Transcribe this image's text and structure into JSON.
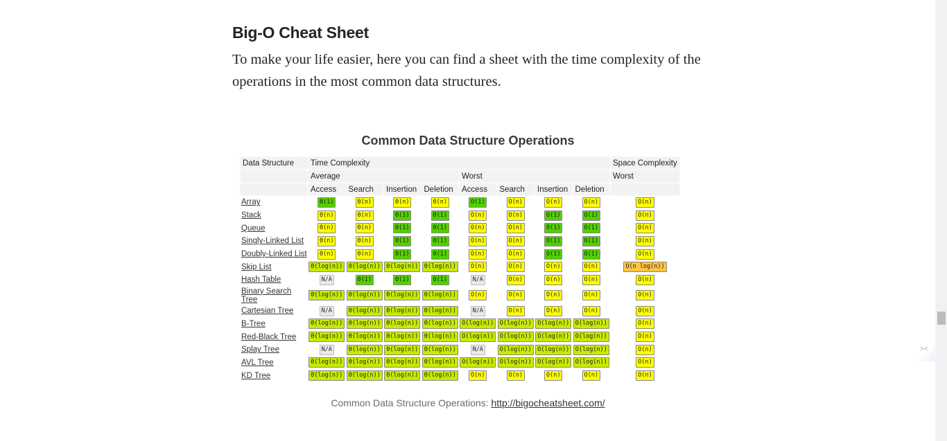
{
  "article": {
    "heading": "Big-O Cheat Sheet",
    "paragraph": "To make your life easier, here you can find a sheet with the time complexity of the operations in the most common data structures."
  },
  "figure": {
    "title": "Common Data Structure Operations",
    "caption_text": "Common Data Structure Operations: ",
    "caption_link": "http://bigocheatsheet.com/",
    "headers": {
      "data_structure": "Data Structure",
      "time_complexity": "Time Complexity",
      "space_complexity": "Space Complexity",
      "average": "Average",
      "worst": "Worst",
      "space_worst": "Worst",
      "ops": [
        "Access",
        "Search",
        "Insertion",
        "Deletion",
        "Access",
        "Search",
        "Insertion",
        "Deletion"
      ]
    },
    "colors": {
      "green": "#53d000",
      "yellow": "#ffff00",
      "yg": "#c8ea00",
      "orange": "#ffc543",
      "gray": "#eaeaea"
    },
    "rows": [
      {
        "name": "Array",
        "cells": [
          [
            "Θ(1)",
            "green"
          ],
          [
            "Θ(n)",
            "yellow"
          ],
          [
            "Θ(n)",
            "yellow"
          ],
          [
            "Θ(n)",
            "yellow"
          ],
          [
            "O(1)",
            "green"
          ],
          [
            "O(n)",
            "yellow"
          ],
          [
            "O(n)",
            "yellow"
          ],
          [
            "O(n)",
            "yellow"
          ],
          [
            "O(n)",
            "yellow"
          ]
        ]
      },
      {
        "name": "Stack",
        "cells": [
          [
            "Θ(n)",
            "yellow"
          ],
          [
            "Θ(n)",
            "yellow"
          ],
          [
            "Θ(1)",
            "green"
          ],
          [
            "Θ(1)",
            "green"
          ],
          [
            "O(n)",
            "yellow"
          ],
          [
            "O(n)",
            "yellow"
          ],
          [
            "O(1)",
            "green"
          ],
          [
            "O(1)",
            "green"
          ],
          [
            "O(n)",
            "yellow"
          ]
        ]
      },
      {
        "name": "Queue",
        "cells": [
          [
            "Θ(n)",
            "yellow"
          ],
          [
            "Θ(n)",
            "yellow"
          ],
          [
            "Θ(1)",
            "green"
          ],
          [
            "Θ(1)",
            "green"
          ],
          [
            "O(n)",
            "yellow"
          ],
          [
            "O(n)",
            "yellow"
          ],
          [
            "O(1)",
            "green"
          ],
          [
            "O(1)",
            "green"
          ],
          [
            "O(n)",
            "yellow"
          ]
        ]
      },
      {
        "name": "Singly-Linked List",
        "cells": [
          [
            "Θ(n)",
            "yellow"
          ],
          [
            "Θ(n)",
            "yellow"
          ],
          [
            "Θ(1)",
            "green"
          ],
          [
            "Θ(1)",
            "green"
          ],
          [
            "O(n)",
            "yellow"
          ],
          [
            "O(n)",
            "yellow"
          ],
          [
            "O(1)",
            "green"
          ],
          [
            "O(1)",
            "green"
          ],
          [
            "O(n)",
            "yellow"
          ]
        ]
      },
      {
        "name": "Doubly-Linked List",
        "cells": [
          [
            "Θ(n)",
            "yellow"
          ],
          [
            "Θ(n)",
            "yellow"
          ],
          [
            "Θ(1)",
            "green"
          ],
          [
            "Θ(1)",
            "green"
          ],
          [
            "O(n)",
            "yellow"
          ],
          [
            "O(n)",
            "yellow"
          ],
          [
            "O(1)",
            "green"
          ],
          [
            "O(1)",
            "green"
          ],
          [
            "O(n)",
            "yellow"
          ]
        ]
      },
      {
        "name": "Skip List",
        "cells": [
          [
            "Θ(log(n))",
            "yg"
          ],
          [
            "Θ(log(n))",
            "yg"
          ],
          [
            "Θ(log(n))",
            "yg"
          ],
          [
            "Θ(log(n))",
            "yg"
          ],
          [
            "O(n)",
            "yellow"
          ],
          [
            "O(n)",
            "yellow"
          ],
          [
            "O(n)",
            "yellow"
          ],
          [
            "O(n)",
            "yellow"
          ],
          [
            "O(n log(n))",
            "orange"
          ]
        ]
      },
      {
        "name": "Hash Table",
        "cells": [
          [
            "N/A",
            "gray"
          ],
          [
            "Θ(1)",
            "green"
          ],
          [
            "Θ(1)",
            "green"
          ],
          [
            "Θ(1)",
            "green"
          ],
          [
            "N/A",
            "gray"
          ],
          [
            "O(n)",
            "yellow"
          ],
          [
            "O(n)",
            "yellow"
          ],
          [
            "O(n)",
            "yellow"
          ],
          [
            "O(n)",
            "yellow"
          ]
        ]
      },
      {
        "name": "Binary Search Tree",
        "cells": [
          [
            "Θ(log(n))",
            "yg"
          ],
          [
            "Θ(log(n))",
            "yg"
          ],
          [
            "Θ(log(n))",
            "yg"
          ],
          [
            "Θ(log(n))",
            "yg"
          ],
          [
            "O(n)",
            "yellow"
          ],
          [
            "O(n)",
            "yellow"
          ],
          [
            "O(n)",
            "yellow"
          ],
          [
            "O(n)",
            "yellow"
          ],
          [
            "O(n)",
            "yellow"
          ]
        ]
      },
      {
        "name": "Cartesian Tree",
        "cells": [
          [
            "N/A",
            "gray"
          ],
          [
            "Θ(log(n))",
            "yg"
          ],
          [
            "Θ(log(n))",
            "yg"
          ],
          [
            "Θ(log(n))",
            "yg"
          ],
          [
            "N/A",
            "gray"
          ],
          [
            "O(n)",
            "yellow"
          ],
          [
            "O(n)",
            "yellow"
          ],
          [
            "O(n)",
            "yellow"
          ],
          [
            "O(n)",
            "yellow"
          ]
        ]
      },
      {
        "name": "B-Tree",
        "cells": [
          [
            "Θ(log(n))",
            "yg"
          ],
          [
            "Θ(log(n))",
            "yg"
          ],
          [
            "Θ(log(n))",
            "yg"
          ],
          [
            "Θ(log(n))",
            "yg"
          ],
          [
            "O(log(n))",
            "yg"
          ],
          [
            "O(log(n))",
            "yg"
          ],
          [
            "O(log(n))",
            "yg"
          ],
          [
            "O(log(n))",
            "yg"
          ],
          [
            "O(n)",
            "yellow"
          ]
        ]
      },
      {
        "name": "Red-Black Tree",
        "cells": [
          [
            "Θ(log(n))",
            "yg"
          ],
          [
            "Θ(log(n))",
            "yg"
          ],
          [
            "Θ(log(n))",
            "yg"
          ],
          [
            "Θ(log(n))",
            "yg"
          ],
          [
            "O(log(n))",
            "yg"
          ],
          [
            "O(log(n))",
            "yg"
          ],
          [
            "O(log(n))",
            "yg"
          ],
          [
            "O(log(n))",
            "yg"
          ],
          [
            "O(n)",
            "yellow"
          ]
        ]
      },
      {
        "name": "Splay Tree",
        "cells": [
          [
            "N/A",
            "gray"
          ],
          [
            "Θ(log(n))",
            "yg"
          ],
          [
            "Θ(log(n))",
            "yg"
          ],
          [
            "Θ(log(n))",
            "yg"
          ],
          [
            "N/A",
            "gray"
          ],
          [
            "O(log(n))",
            "yg"
          ],
          [
            "O(log(n))",
            "yg"
          ],
          [
            "O(log(n))",
            "yg"
          ],
          [
            "O(n)",
            "yellow"
          ]
        ]
      },
      {
        "name": "AVL Tree",
        "cells": [
          [
            "Θ(log(n))",
            "yg"
          ],
          [
            "Θ(log(n))",
            "yg"
          ],
          [
            "Θ(log(n))",
            "yg"
          ],
          [
            "Θ(log(n))",
            "yg"
          ],
          [
            "O(log(n))",
            "yg"
          ],
          [
            "O(log(n))",
            "yg"
          ],
          [
            "O(log(n))",
            "yg"
          ],
          [
            "O(log(n))",
            "yg"
          ],
          [
            "O(n)",
            "yellow"
          ]
        ]
      },
      {
        "name": "KD Tree",
        "cells": [
          [
            "Θ(log(n))",
            "yg"
          ],
          [
            "Θ(log(n))",
            "yg"
          ],
          [
            "Θ(log(n))",
            "yg"
          ],
          [
            "Θ(log(n))",
            "yg"
          ],
          [
            "O(n)",
            "yellow"
          ],
          [
            "O(n)",
            "yellow"
          ],
          [
            "O(n)",
            "yellow"
          ],
          [
            "O(n)",
            "yellow"
          ],
          [
            "O(n)",
            "yellow"
          ]
        ]
      }
    ]
  },
  "widget": {
    "icon": "><"
  }
}
